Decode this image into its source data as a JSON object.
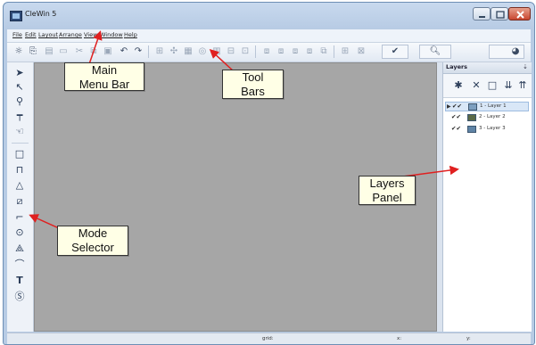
{
  "window": {
    "title": "CleWin 5",
    "controls": {
      "minimize_icon": "minimize-icon",
      "maximize_icon": "maximize-icon",
      "close_icon": "close-icon"
    }
  },
  "menu": {
    "items": [
      "File",
      "Edit",
      "Layout",
      "Arrange",
      "View",
      "Window",
      "Help"
    ]
  },
  "layers_panel": {
    "title": "Layers",
    "layers": [
      {
        "name": "1 - Layer 1",
        "color": "#7d9fc0",
        "selected": true
      },
      {
        "name": "2 - Layer 2",
        "color": "#5a6a48",
        "selected": false
      },
      {
        "name": "3 - Layer 3",
        "color": "#5f84a6",
        "selected": false
      }
    ]
  },
  "status": {
    "grid_label": "grid:",
    "x_label": "x:",
    "y_label": "y:"
  },
  "annotations": {
    "main_menu_bar": "Main\nMenu Bar",
    "tool_bars": "Tool\nBars",
    "layers_panel": "Layers\nPanel",
    "mode_selector": "Mode\nSelector"
  },
  "colors": {
    "canvas": "#a6a6a6",
    "callout_fill": "#ffffe6",
    "arrow": "#e02020"
  }
}
